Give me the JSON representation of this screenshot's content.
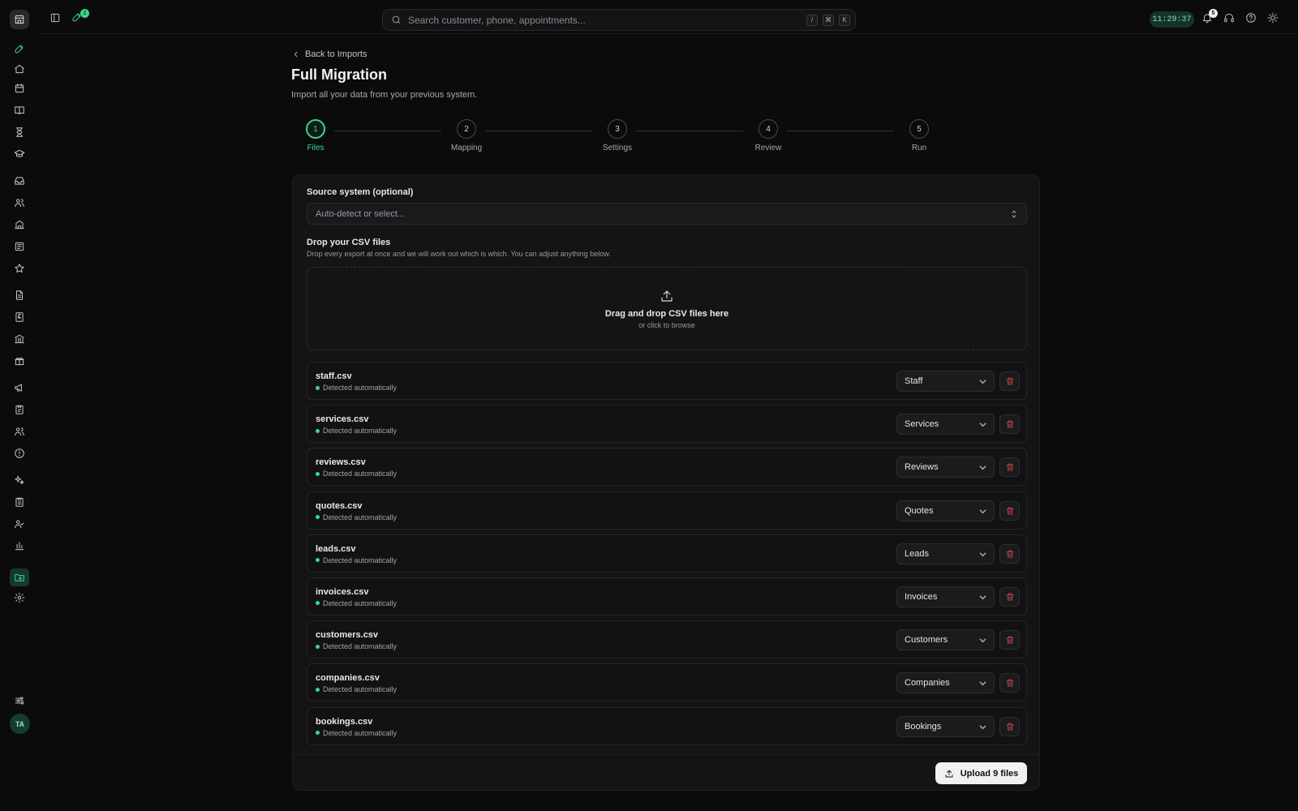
{
  "topbar": {
    "search_placeholder": "Search customer, phone, appointments...",
    "shortcut_keys": [
      "/",
      "⌘",
      "K"
    ],
    "rocket_badge": "2",
    "notification_badge": "5",
    "clock": "11:29:37"
  },
  "user": {
    "initials": "TA"
  },
  "page": {
    "back_label": "Back to Imports",
    "title": "Full Migration",
    "subtitle": "Import all your data from your previous system."
  },
  "steps": [
    {
      "num": "1",
      "label": "Files",
      "active": true
    },
    {
      "num": "2",
      "label": "Mapping"
    },
    {
      "num": "3",
      "label": "Settings"
    },
    {
      "num": "4",
      "label": "Review"
    },
    {
      "num": "5",
      "label": "Run"
    }
  ],
  "source": {
    "label": "Source system (optional)",
    "placeholder": "Auto-detect or select..."
  },
  "dropzone": {
    "label": "Drop your CSV files",
    "hint": "Drop every export at once and we will work out which is which. You can adjust anything below.",
    "main_text": "Drag and drop CSV files here",
    "sub_text": "or click to browse"
  },
  "files": [
    {
      "name": "staff.csv",
      "status": "Detected automatically",
      "type": "Staff"
    },
    {
      "name": "services.csv",
      "status": "Detected automatically",
      "type": "Services"
    },
    {
      "name": "reviews.csv",
      "status": "Detected automatically",
      "type": "Reviews"
    },
    {
      "name": "quotes.csv",
      "status": "Detected automatically",
      "type": "Quotes"
    },
    {
      "name": "leads.csv",
      "status": "Detected automatically",
      "type": "Leads"
    },
    {
      "name": "invoices.csv",
      "status": "Detected automatically",
      "type": "Invoices"
    },
    {
      "name": "customers.csv",
      "status": "Detected automatically",
      "type": "Customers"
    },
    {
      "name": "companies.csv",
      "status": "Detected automatically",
      "type": "Companies"
    },
    {
      "name": "bookings.csv",
      "status": "Detected automatically",
      "type": "Bookings"
    }
  ],
  "upload_button": "Upload 9 files",
  "colors": {
    "accent": "#3dd68c",
    "danger": "#e5484d",
    "background": "#0b0b0c",
    "card": "#141416"
  }
}
